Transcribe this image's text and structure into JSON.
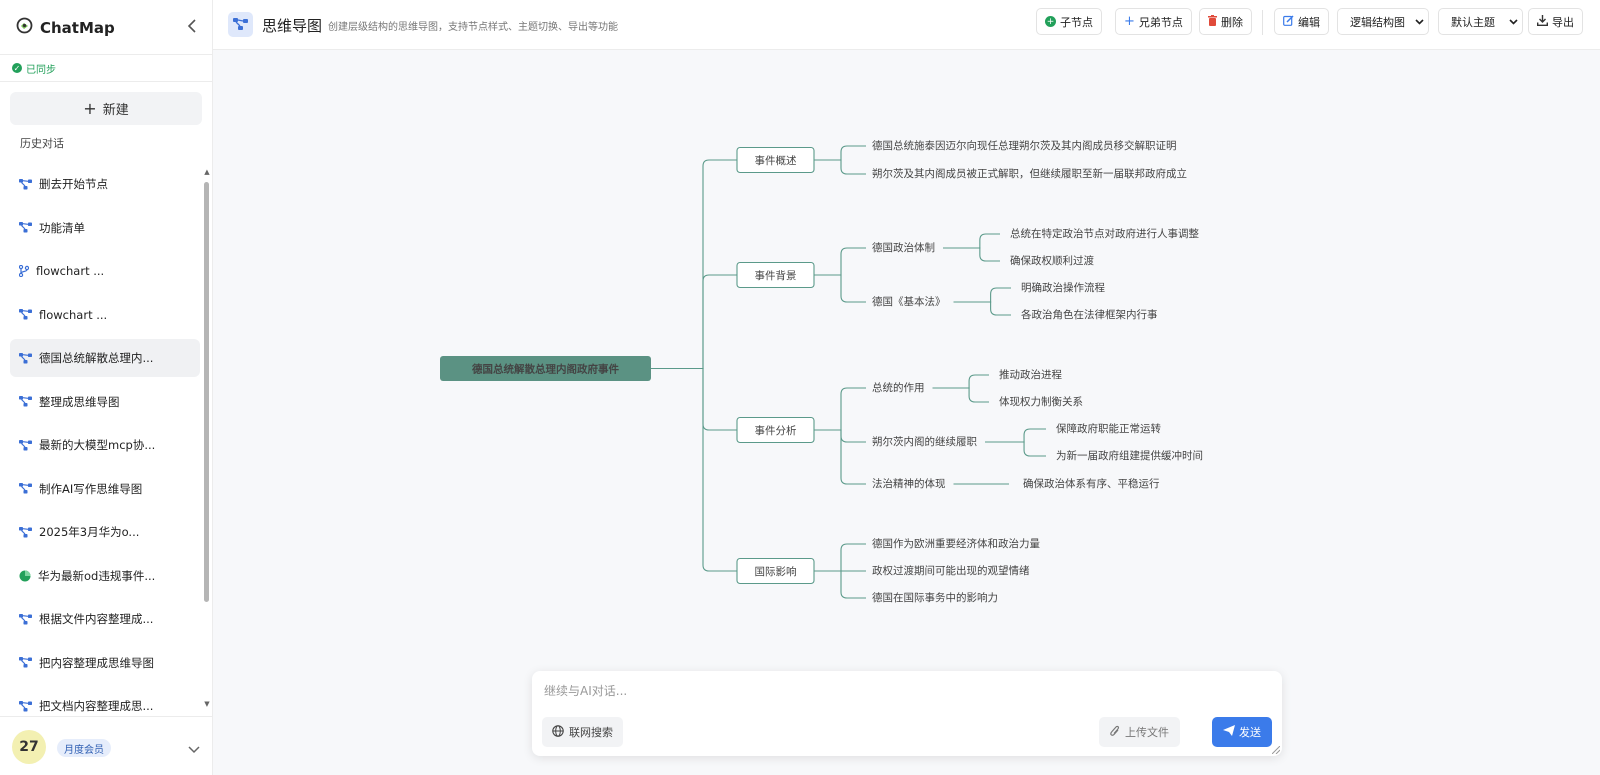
{
  "app": {
    "name": "ChatMap"
  },
  "sidebar": {
    "sync_status": "已同步",
    "new_label": "新建",
    "history_title": "历史对话",
    "items": [
      {
        "label": "删去开始节点",
        "icon": "mindmap-icon"
      },
      {
        "label": "功能清单",
        "icon": "mindmap-icon"
      },
      {
        "label": "flowchart ...",
        "icon": "flowchart-icon"
      },
      {
        "label": "flowchart ...",
        "icon": "mindmap-icon"
      },
      {
        "label": "德国总统解散总理内...",
        "icon": "mindmap-icon",
        "active": true
      },
      {
        "label": "整理成思维导图",
        "icon": "mindmap-icon"
      },
      {
        "label": "最新的大模型mcp协...",
        "icon": "mindmap-icon"
      },
      {
        "label": "制作AI写作思维导图",
        "icon": "mindmap-icon"
      },
      {
        "label": "2025年3月华为o...",
        "icon": "mindmap-icon"
      },
      {
        "label": "华为最新od违规事件...",
        "icon": "pie-icon"
      },
      {
        "label": "根据文件内容整理成...",
        "icon": "mindmap-icon"
      },
      {
        "label": "把内容整理成思维导图",
        "icon": "mindmap-icon"
      },
      {
        "label": "把文档内容整理成思...",
        "icon": "mindmap-icon"
      }
    ],
    "user": {
      "avatar_text": "27",
      "membership": "月度会员"
    }
  },
  "header": {
    "title": "思维导图",
    "subtitle": "创建层级结构的思维导图，支持节点样式、主题切换、导出等功能",
    "buttons": {
      "child_node": "子节点",
      "sibling_node": "兄弟节点",
      "delete": "删除",
      "edit": "编辑",
      "export": "导出"
    },
    "layout_select": "逻辑结构图",
    "theme_select": "默认主题"
  },
  "mindmap": {
    "root": "德国总统解散总理内阁政府事件",
    "branches": [
      {
        "label": "事件概述",
        "children": [
          {
            "label": "德国总统施泰因迈尔向现任总理朔尔茨及其内阁成员移交解职证明",
            "children": []
          },
          {
            "label": "朔尔茨及其内阁成员被正式解职，但继续履职至新一届联邦政府成立",
            "children": []
          }
        ]
      },
      {
        "label": "事件背景",
        "children": [
          {
            "label": "德国政治体制",
            "children": [
              "总统在特定政治节点对政府进行人事调整",
              "确保政权顺利过渡"
            ]
          },
          {
            "label": "德国《基本法》",
            "children": [
              "明确政治操作流程",
              "各政治角色在法律框架内行事"
            ]
          }
        ]
      },
      {
        "label": "事件分析",
        "children": [
          {
            "label": "总统的作用",
            "children": [
              "推动政治进程",
              "体现权力制衡关系"
            ]
          },
          {
            "label": "朔尔茨内阁的继续履职",
            "children": [
              "保障政府职能正常运转",
              "为新一届政府组建提供缓冲时间"
            ]
          },
          {
            "label": "法治精神的体现",
            "children": [
              "确保政治体系有序、平稳运行"
            ]
          }
        ]
      },
      {
        "label": "国际影响",
        "children": [
          {
            "label": "德国作为欧洲重要经济体和政治力量",
            "children": []
          },
          {
            "label": "政权过渡期间可能出现的观望情绪",
            "children": []
          },
          {
            "label": "德国在国际事务中的影响力",
            "children": []
          }
        ]
      }
    ]
  },
  "chat": {
    "placeholder": "继续与AI对话...",
    "web_search": "联网搜索",
    "upload": "上传文件",
    "send": "发送"
  },
  "colors": {
    "root_fill": "#5b9283",
    "line": "#5b9a8a",
    "accent": "#3b7bea",
    "sync": "#22a05a"
  }
}
